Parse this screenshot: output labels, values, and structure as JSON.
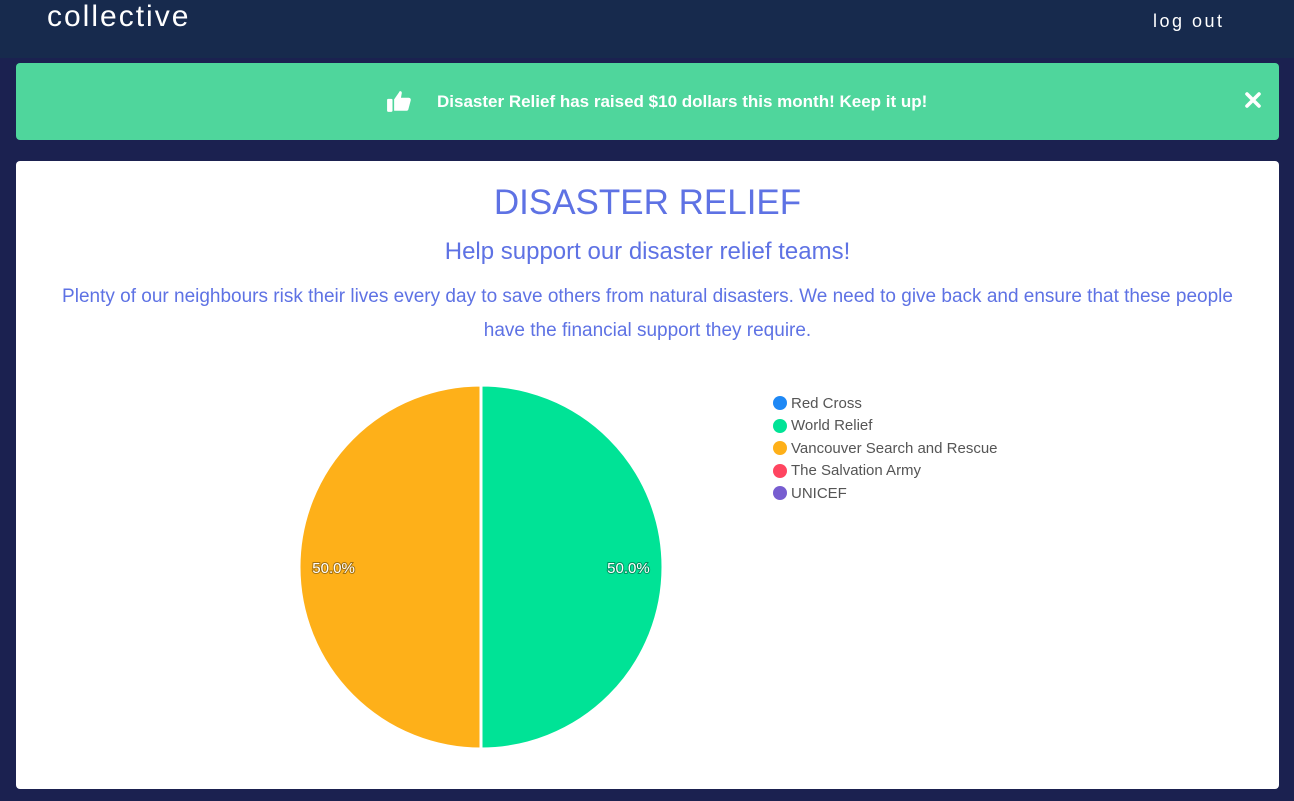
{
  "header": {
    "brand": "collective",
    "logout_label": "log out"
  },
  "alert": {
    "icon": "thumbs-up-icon",
    "message": "Disaster Relief has raised $10 dollars this month! Keep it up!",
    "close_icon": "close-icon",
    "color": "#4fd69c"
  },
  "main": {
    "title": "DISASTER RELIEF",
    "subtitle": "Help support our disaster relief teams!",
    "description": "Plenty of our neighbours risk their lives every day to save others from natural disasters. We need to give back and ensure that these people have the financial support they require."
  },
  "colors": {
    "topbar": "#172a4d",
    "page_background": "#1b2150",
    "accent": "#5e72e4"
  },
  "chart_data": {
    "type": "pie",
    "legend_position": "right",
    "series": [
      {
        "name": "Red Cross",
        "value": 0,
        "color": "#1e88f5"
      },
      {
        "name": "World Relief",
        "value": 50,
        "color": "#00e396",
        "label": "50.0%"
      },
      {
        "name": "Vancouver Search and Rescue",
        "value": 50,
        "color": "#feb019",
        "label": "50.0%"
      },
      {
        "name": "The Salvation Army",
        "value": 0,
        "color": "#ff4560"
      },
      {
        "name": "UNICEF",
        "value": 0,
        "color": "#775dd0"
      }
    ]
  }
}
